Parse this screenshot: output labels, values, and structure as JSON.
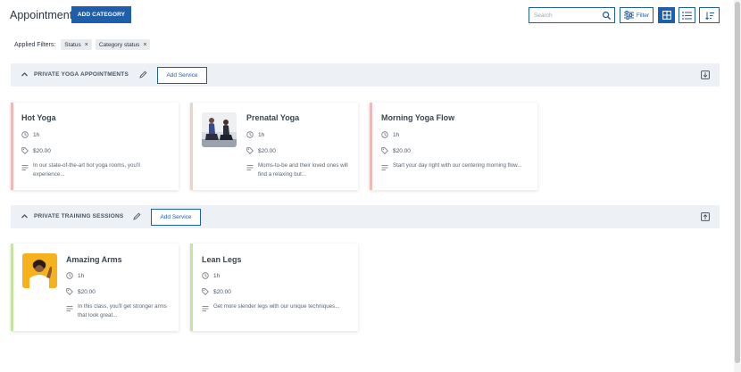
{
  "header": {
    "title": "Appointments",
    "add_category_label": "ADD CATEGORY",
    "search_placeholder": "Search",
    "filter_label": "Filter"
  },
  "filters": {
    "label": "Applied Filters:",
    "chips": [
      {
        "label": "Status",
        "remove": "×"
      },
      {
        "label": "Category status",
        "remove": "×"
      }
    ]
  },
  "sections": [
    {
      "title": "PRIVATE YOGA APPOINTMENTS",
      "add_service_label": "Add Service",
      "cards": [
        {
          "title": "Hot Yoga",
          "duration": "1h",
          "price": "$20.00",
          "description": "In our state-of-the-art hot yoga rooms, you'll experience...",
          "accent": "#f2b8b8",
          "has_image": false
        },
        {
          "title": "Prenatal Yoga",
          "duration": "1h",
          "price": "$20.00",
          "description": "Moms-to-be and their loved ones will find a relaxing but...",
          "accent": "#efd3c2",
          "has_image": true
        },
        {
          "title": "Morning Yoga Flow",
          "duration": "1h",
          "price": "$20.00",
          "description": "Start your day right with our centering morning flow...",
          "accent": "#f2b8b8",
          "has_image": false
        }
      ]
    },
    {
      "title": "PRIVATE TRAINING SESSIONS",
      "add_service_label": "Add Service",
      "cards": [
        {
          "title": "Amazing Arms",
          "duration": "1h",
          "price": "$20.00",
          "description": "In this class, you'll get stronger arms that look great...",
          "accent": "#c5e4a0",
          "has_image": true
        },
        {
          "title": "Lean Legs",
          "duration": "1h",
          "price": "$20.00",
          "description": "Get more slender legs with our unique techniques...",
          "accent": "#c5e4a0",
          "has_image": false
        }
      ]
    }
  ],
  "colors": {
    "primary": "#1f5ea8",
    "section_bg": "#edf0f4"
  }
}
